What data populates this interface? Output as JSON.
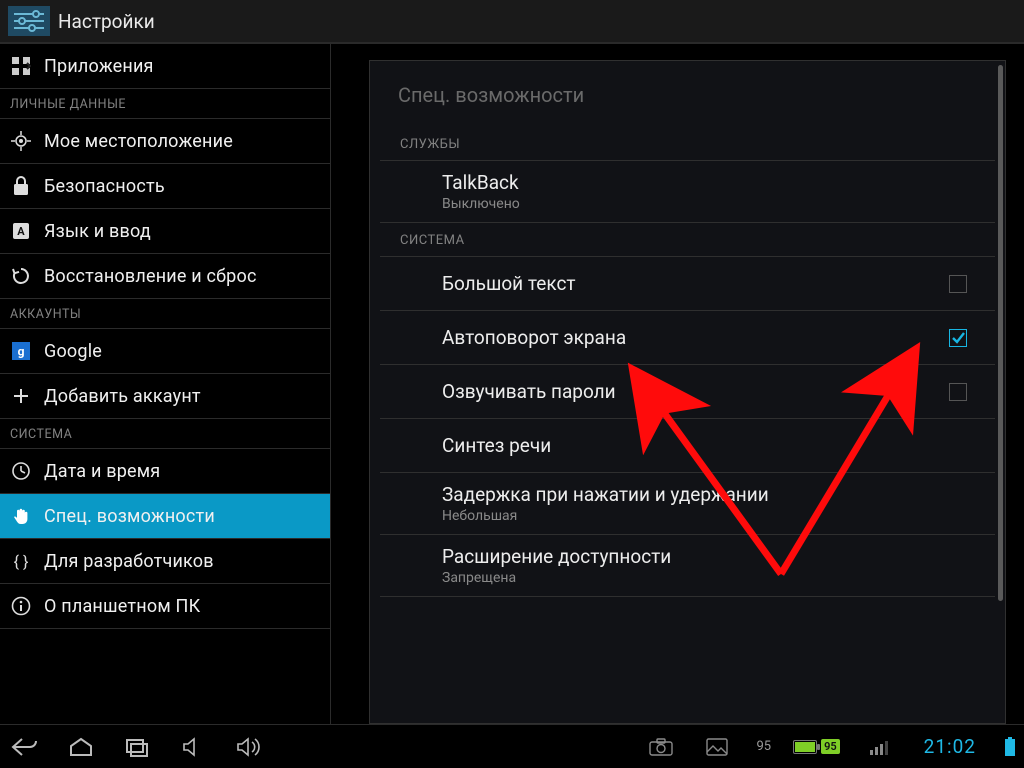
{
  "title": "Настройки",
  "sidebar": {
    "items": [
      {
        "icon": "apps",
        "label": "Приложения"
      }
    ],
    "section_personal": "ЛИЧНЫЕ ДАННЫЕ",
    "personal": [
      {
        "icon": "location",
        "label": "Мое местоположение"
      },
      {
        "icon": "lock",
        "label": "Безопасность"
      },
      {
        "icon": "language",
        "label": "Язык и ввод"
      },
      {
        "icon": "restore",
        "label": "Восстановление и сброс"
      }
    ],
    "section_accounts": "АККАУНТЫ",
    "accounts": [
      {
        "icon": "google",
        "label": "Google"
      },
      {
        "icon": "plus",
        "label": "Добавить аккаунт"
      }
    ],
    "section_system": "СИСТЕМА",
    "system": [
      {
        "icon": "clock",
        "label": "Дата и время"
      },
      {
        "icon": "hand",
        "label": "Спец. возможности",
        "selected": true
      },
      {
        "icon": "braces",
        "label": "Для разработчиков"
      },
      {
        "icon": "info",
        "label": "О планшетном ПК"
      }
    ]
  },
  "panel": {
    "title": "Спец. возможности",
    "section_services": "СЛУЖБЫ",
    "talkback": {
      "title": "TalkBack",
      "sub": "Выключено"
    },
    "section_system": "СИСТЕМА",
    "rows": {
      "large_text": {
        "label": "Большой текст"
      },
      "auto_rotate": {
        "label": "Автоповорот экрана"
      },
      "speak_pw": {
        "label": "Озвучивать пароли"
      },
      "tts": {
        "label": "Синтез речи"
      },
      "touch_delay": {
        "label": "Задержка при нажатии и удержании",
        "sub": "Небольшая"
      },
      "a11y_ext": {
        "label": "Расширение доступности",
        "sub": "Запрещена"
      }
    }
  },
  "navbar": {
    "battery_pct": "95",
    "time": "21:02"
  }
}
